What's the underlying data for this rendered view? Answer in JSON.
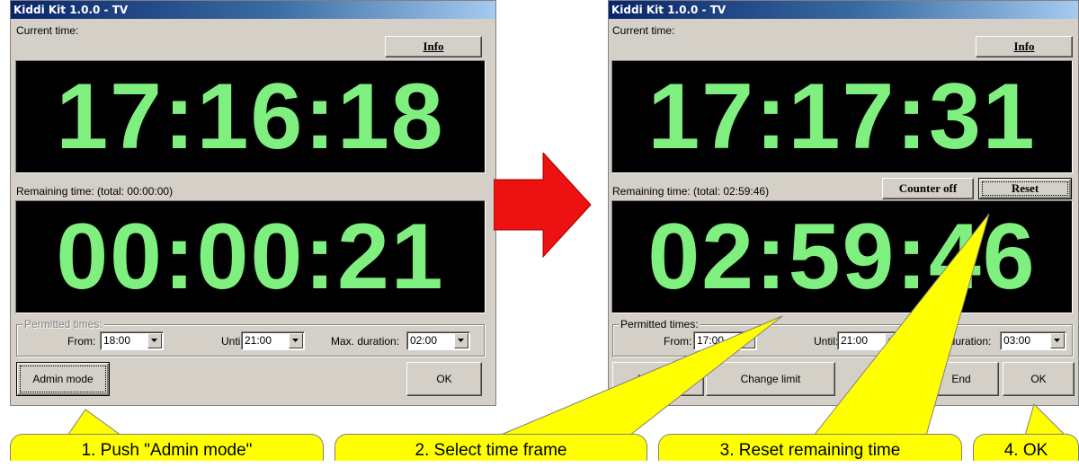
{
  "windows": [
    {
      "title": "Kiddi Kit 1.0.0 - TV",
      "current_time_label": "Current time:",
      "info_button": "Info",
      "current_time": "17:16:18",
      "remaining_label": "Remaining time: (total: 00:00:00)",
      "remaining_time": "00:00:21",
      "permitted_times_label": "Permitted times:",
      "from_label": "From:",
      "from_value": "18:00",
      "until_label": "Until:",
      "until_value": "21:00",
      "max_duration_label": "Max. duration:",
      "max_duration_value": "02:00",
      "admin_button": "Admin mode",
      "ok_button": "OK"
    },
    {
      "title": "Kiddi Kit 1.0.0 - TV",
      "current_time_label": "Current time:",
      "info_button": "Info",
      "current_time": "17:17:31",
      "remaining_label": "Remaining time: (total: 02:59:46)",
      "counter_off_button": "Counter off",
      "reset_button": "Reset",
      "remaining_time": "02:59:46",
      "permitted_times_label": "Permitted times:",
      "from_label": "From:",
      "from_value": "17:00",
      "until_label": "Until:",
      "until_value": "21:00",
      "max_duration_label": "x. duration:",
      "max_duration_value": "03:00",
      "admin_off_button": "Admin off",
      "change_limit_button": "Change limit",
      "end_button": "End",
      "ok_button": "OK"
    }
  ],
  "callouts": [
    "1. Push \"Admin mode\"",
    "2. Select time frame",
    "3. Reset remaining time",
    "4. OK"
  ],
  "colors": {
    "digits": "#7ff07f",
    "display_bg": "#000000",
    "callout": "#ffff00",
    "arrow": "#ee1111"
  }
}
